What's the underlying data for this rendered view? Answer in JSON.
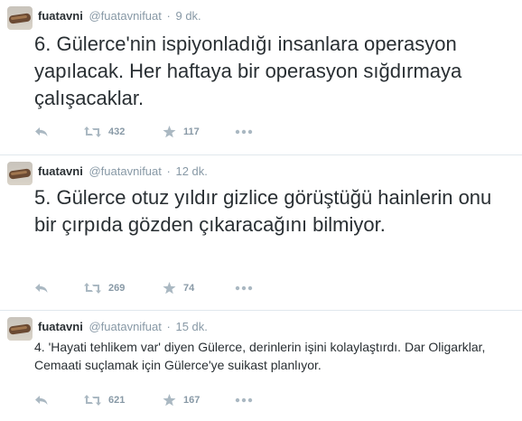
{
  "tweets": [
    {
      "name": "fuatavni",
      "handle": "@fuatavnifuat",
      "dot": "·",
      "time": "9 dk.",
      "text": "6. Gülerce'nin ispiyonladığı insanlara operasyon yapılacak. Her haftaya bir operasyon sığdırmaya çalışacaklar.",
      "retweets": "432",
      "favorites": "117"
    },
    {
      "name": "fuatavni",
      "handle": "@fuatavnifuat",
      "dot": "·",
      "time": "12 dk.",
      "text": "5. Gülerce otuz yıldır gizlice görüştüğü hainlerin onu bir çırpıda gözden çıkaracağını bilmiyor.",
      "retweets": "269",
      "favorites": "74"
    },
    {
      "name": "fuatavni",
      "handle": "@fuatavnifuat",
      "dot": "·",
      "time": "15 dk.",
      "text": "4. 'Hayati tehlikem var' diyen Gülerce, derinlerin işini kolaylaştırdı. Dar Oligarklar, Cemaati suçlamak için Gülerce'ye suikast planlıyor.",
      "retweets": "621",
      "favorites": "167"
    }
  ],
  "icons": [
    "avatar",
    "reply-icon",
    "retweet-icon",
    "favorite-icon",
    "more-icon"
  ],
  "colors": {
    "text": "#292f33",
    "muted": "#8899a6",
    "icon": "#aab8c2",
    "divider": "#e1e8ed"
  }
}
